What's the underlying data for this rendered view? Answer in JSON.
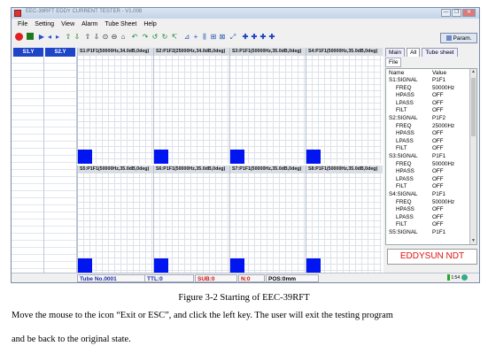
{
  "window": {
    "title": "EEC-39RFT EDDY CURRENT TESTER - V1.008",
    "controls": [
      "—",
      "❐",
      "✕"
    ]
  },
  "menu": [
    "File",
    "Setting",
    "View",
    "Alarm",
    "Tube Sheet",
    "Help"
  ],
  "toolbar": {
    "icons": [
      "record-icon",
      "stop-icon",
      "play-icon",
      "back-icon",
      "forward-icon",
      "up-icon",
      "down-icon",
      "balance-icon",
      "flip-icon",
      "dot-icon",
      "hold-icon",
      "exit-icon",
      "rotate-ccw-icon",
      "rotate-cw-icon",
      "rotate-icon",
      "phase-icon",
      "zoom-icon",
      "add-icon",
      "strip-icon",
      "chart-icon",
      "grid-icon",
      "crosshair-icon",
      "cross-icon",
      "cross-icon",
      "cross-icon",
      "cross-icon"
    ],
    "param_label": "Param."
  },
  "channels": {
    "tabs": [
      "S1.Y",
      "S2.Y"
    ],
    "accent": "#1e44c8",
    "signal_color": "#0015f0",
    "panels": [
      "S1:P1F1(50000Hz,34.0dB,0deg)",
      "S2:P1F2(25000Hz,34.0dB,0deg)",
      "S3:P1F1(50000Hz,35.0dB,0deg)",
      "S4:P1F1(50000Hz,35.0dB,0deg)",
      "S5:P1F1(50000Hz,35.0dB,0deg)",
      "S6:P1F1(50000Hz,35.0dB,0deg)",
      "S7:P1F1(50000Hz,35.0dB,0deg)",
      "S8:P1F1(50000Hz,35.0dB,0deg)"
    ]
  },
  "sidepanel": {
    "tabs": [
      "Main",
      "All",
      "Tube sheet"
    ],
    "file_label": "File",
    "columns": [
      "Name",
      "Value"
    ],
    "rows": [
      {
        "name": "S1:SIGNAL",
        "value": "P1F1",
        "sub": false
      },
      {
        "name": "FREQ",
        "value": "50000Hz",
        "sub": true
      },
      {
        "name": "HPASS",
        "value": "OFF",
        "sub": true
      },
      {
        "name": "LPASS",
        "value": "OFF",
        "sub": true
      },
      {
        "name": "FILT",
        "value": "OFF",
        "sub": true
      },
      {
        "name": "S2:SIGNAL",
        "value": "P1F2",
        "sub": false
      },
      {
        "name": "FREQ",
        "value": "25000Hz",
        "sub": true
      },
      {
        "name": "HPASS",
        "value": "OFF",
        "sub": true
      },
      {
        "name": "LPASS",
        "value": "OFF",
        "sub": true
      },
      {
        "name": "FILT",
        "value": "OFF",
        "sub": true
      },
      {
        "name": "S3:SIGNAL",
        "value": "P1F1",
        "sub": false
      },
      {
        "name": "FREQ",
        "value": "50000Hz",
        "sub": true
      },
      {
        "name": "HPASS",
        "value": "OFF",
        "sub": true
      },
      {
        "name": "LPASS",
        "value": "OFF",
        "sub": true
      },
      {
        "name": "FILT",
        "value": "OFF",
        "sub": true
      },
      {
        "name": "S4:SIGNAL",
        "value": "P1F1",
        "sub": false
      },
      {
        "name": "FREQ",
        "value": "50000Hz",
        "sub": true
      },
      {
        "name": "HPASS",
        "value": "OFF",
        "sub": true
      },
      {
        "name": "LPASS",
        "value": "OFF",
        "sub": true
      },
      {
        "name": "FILT",
        "value": "OFF",
        "sub": true
      },
      {
        "name": "S5:SIGNAL",
        "value": "P1F1",
        "sub": false
      }
    ],
    "brand": "EDDYSUN NDT"
  },
  "status": {
    "tube": "Tube No.0001",
    "ttl": "TTL:0",
    "sub": "SUB:0",
    "n": "N:0",
    "pos": "POS:0mm",
    "icon_text": "1:54",
    "tube_color": "#1a2ea8",
    "sub_color": "#d01010"
  },
  "doc": {
    "caption": "Figure 3-2 Starting of EEC-39RFT",
    "line1": "Move the mouse to the icon “Exit or ESC”, and click the left key. The user will exit the testing program",
    "line2": "and be back to the original state."
  }
}
